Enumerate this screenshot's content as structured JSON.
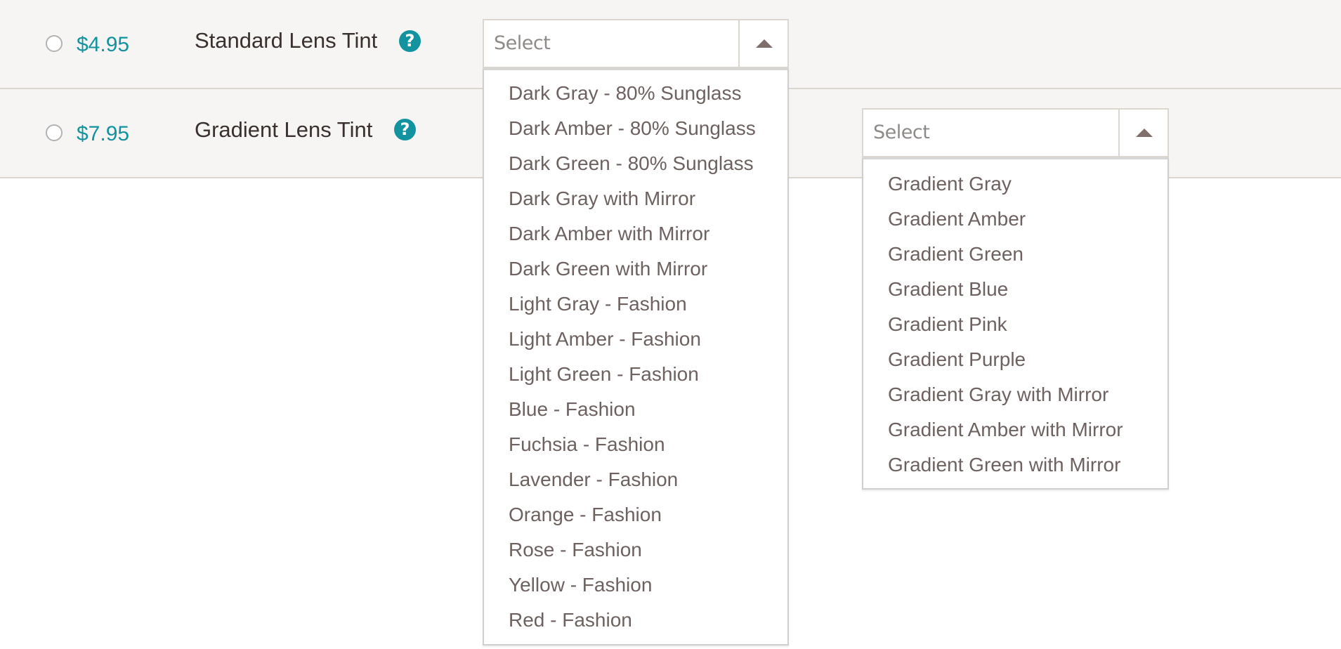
{
  "rows": [
    {
      "price": "$4.95",
      "label": "Standard Lens Tint",
      "help_icon": "?",
      "select": {
        "placeholder": "Select",
        "expanded": true,
        "options": [
          "Dark Gray - 80% Sunglass",
          "Dark Amber - 80% Sunglass",
          "Dark Green - 80% Sunglass",
          "Dark Gray with Mirror",
          "Dark Amber with Mirror",
          "Dark Green with Mirror",
          "Light Gray - Fashion",
          "Light Amber - Fashion",
          "Light Green - Fashion",
          "Blue - Fashion",
          "Fuchsia - Fashion",
          "Lavender - Fashion",
          "Orange - Fashion",
          "Rose - Fashion",
          "Yellow - Fashion",
          "Red - Fashion"
        ]
      }
    },
    {
      "price": "$7.95",
      "label": "Gradient Lens Tint",
      "help_icon": "?",
      "select": {
        "placeholder": "Select",
        "expanded": true,
        "options": [
          "Gradient Gray",
          "Gradient Amber",
          "Gradient Green",
          "Gradient Blue",
          "Gradient Pink",
          "Gradient Purple",
          "Gradient Gray with Mirror",
          "Gradient Amber with Mirror",
          "Gradient Green with Mirror"
        ]
      }
    }
  ],
  "colors": {
    "accent": "#13939f",
    "label_text": "#3a302e",
    "option_text": "#6e6260",
    "placeholder_text": "#8e8a88",
    "row_background": "#f6f5f3",
    "border": "#dcd6d0"
  }
}
